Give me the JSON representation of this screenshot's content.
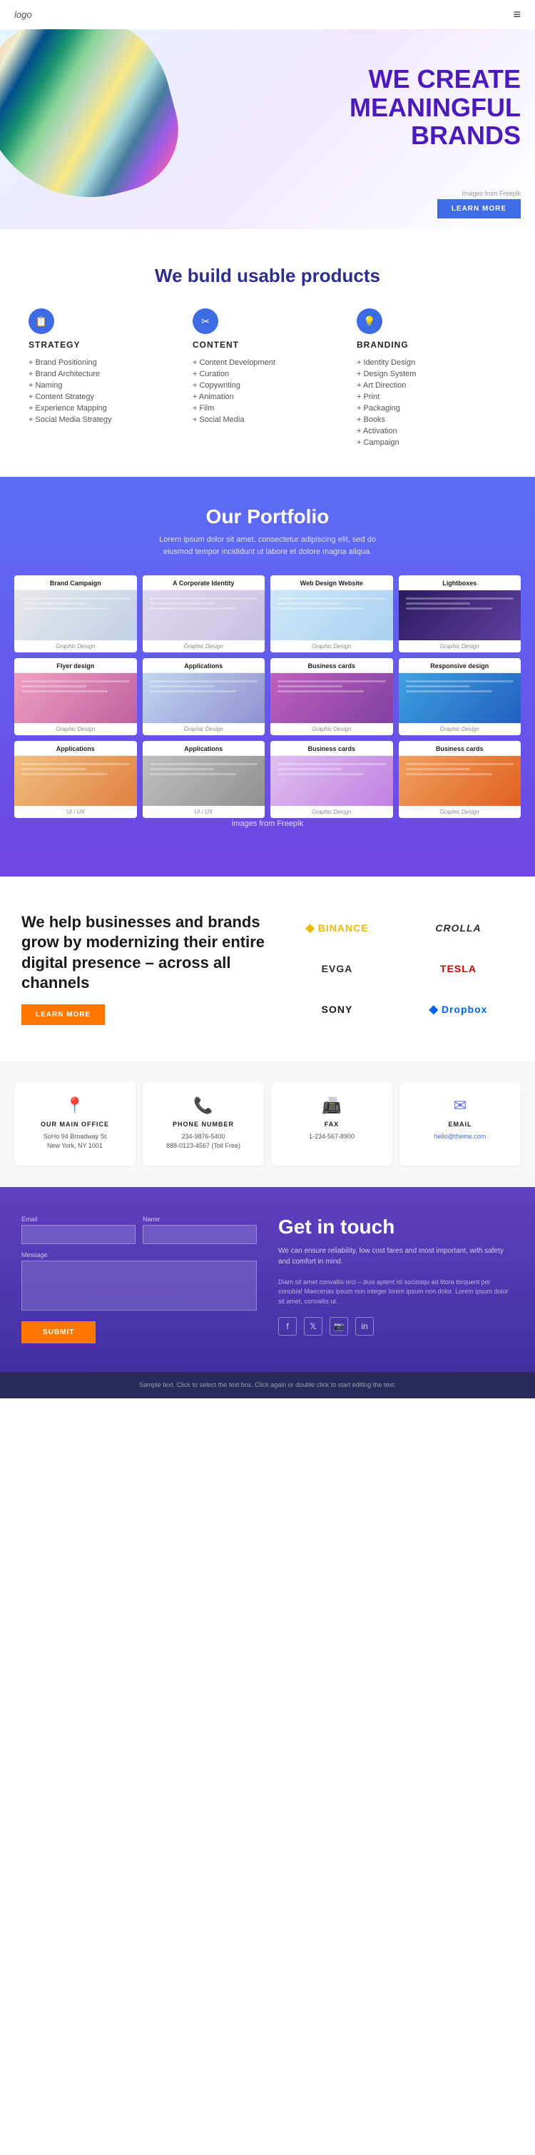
{
  "header": {
    "logo": "logo",
    "hamburger": "≡"
  },
  "hero": {
    "line1": "WE CREATE",
    "line2": "MEANINGFUL",
    "line3": "BRANDS",
    "source": "Images from Freepik",
    "button_label": "LEARN MORE"
  },
  "products_section": {
    "title": "We build usable products",
    "columns": [
      {
        "id": "strategy",
        "icon": "📋",
        "heading": "STRATEGY",
        "items": [
          "Brand Positioning",
          "Brand Architecture",
          "Naming",
          "Content Strategy",
          "Experience Mapping",
          "Social Media Strategy"
        ]
      },
      {
        "id": "content",
        "icon": "✂",
        "heading": "CONTENT",
        "items": [
          "Content Development",
          "Curation",
          "Copywriting",
          "Animation",
          "Film",
          "Social Media"
        ]
      },
      {
        "id": "branding",
        "icon": "💡",
        "heading": "BRANDING",
        "items": [
          "Identity Design",
          "Design System",
          "Art Direction",
          "Print",
          "Packaging",
          "Books",
          "Activation",
          "Campaign"
        ]
      }
    ]
  },
  "portfolio_section": {
    "title": "Our Portfolio",
    "description": "Lorem ipsum dolor sit amet, consectetur adipiscing elit, sed do eiusmod tempor incididunt ut labore et dolore magna aliqua.",
    "freepik_note": "images from Freepik",
    "cards": [
      {
        "id": "brand-campaign",
        "title": "Brand Campaign",
        "category": "Graphic Design",
        "img_class": "img-brand"
      },
      {
        "id": "corporate-identity",
        "title": "A Corporate Identity",
        "category": "Graphic Design",
        "img_class": "img-corporate"
      },
      {
        "id": "web-design",
        "title": "Web Design Website",
        "category": "Graphic Design",
        "img_class": "img-webdesign"
      },
      {
        "id": "lightboxes",
        "title": "Lightboxes",
        "category": "Graphic Design",
        "img_class": "img-lightboxes"
      },
      {
        "id": "flyer-design",
        "title": "Flyer design",
        "category": "Graphic Design",
        "img_class": "img-flyer"
      },
      {
        "id": "applications1",
        "title": "Applications",
        "category": "Graphic Design",
        "img_class": "img-applications"
      },
      {
        "id": "business-cards1",
        "title": "Business cards",
        "category": "Graphic Design",
        "img_class": "img-businesscards"
      },
      {
        "id": "responsive-design",
        "title": "Responsive design",
        "category": "Graphic Design",
        "img_class": "img-responsive"
      },
      {
        "id": "applications2",
        "title": "Applications",
        "category": "UI / UX",
        "img_class": "img-app2"
      },
      {
        "id": "applications3",
        "title": "Applications",
        "category": "UI / UX",
        "img_class": "img-app3"
      },
      {
        "id": "business-cards2",
        "title": "Business cards",
        "category": "Graphic Design",
        "img_class": "img-biz2"
      },
      {
        "id": "business-cards3",
        "title": "Business cards",
        "category": "Graphic Design",
        "img_class": "img-biz3"
      }
    ]
  },
  "brands_section": {
    "heading": "We help businesses and brands grow by modernizing their entire digital presence – across all channels",
    "button_label": "LEARN MORE",
    "logos": [
      {
        "id": "binance",
        "symbol": "◆",
        "name": "BINANCE",
        "class": "binance"
      },
      {
        "id": "crolla",
        "symbol": "",
        "name": "CROLLA",
        "class": "crolla"
      },
      {
        "id": "evga",
        "symbol": "",
        "name": "EVGA",
        "class": "evga"
      },
      {
        "id": "tesla",
        "symbol": "",
        "name": "TESLA",
        "class": "tesla"
      },
      {
        "id": "sony",
        "symbol": "",
        "name": "SONY",
        "class": "sony"
      },
      {
        "id": "dropbox",
        "symbol": "◆",
        "name": "Dropbox",
        "class": "dropbox"
      }
    ]
  },
  "contact_cards": [
    {
      "id": "office",
      "icon": "📍",
      "label": "OUR MAIN OFFICE",
      "value": "SoHo 94 Broadway St\nNew York, NY 1001"
    },
    {
      "id": "phone",
      "icon": "📞",
      "label": "PHONE NUMBER",
      "value": "234-9876-5400\n888-0123-4567 (Toll Free)"
    },
    {
      "id": "fax",
      "icon": "📠",
      "label": "FAX",
      "value": "1-234-567-8900"
    },
    {
      "id": "email",
      "icon": "✉",
      "label": "EMAIL",
      "value": "hello@theme.com"
    }
  ],
  "get_in_touch": {
    "heading": "Get in touch",
    "tagline": "We can ensure reliability, low cost fares and most important, with safety and comfort in mind.",
    "body_text": "Diam sit amet convallis orci – duis aptent isl sociosqu ad litora torquent per conubia! Maecenas ipsum non integer lorem ipsum non dolor. Lorem ipsum dolor sit amet, convallis ut.",
    "form": {
      "email_label": "Email",
      "name_label": "Name",
      "message_label": "Message",
      "submit_label": "SUBMIT"
    },
    "social": [
      {
        "id": "facebook",
        "icon": "f"
      },
      {
        "id": "twitter",
        "icon": "𝕏"
      },
      {
        "id": "instagram",
        "icon": "📷"
      },
      {
        "id": "linkedin",
        "icon": "in"
      }
    ]
  },
  "footer": {
    "note": "Sample text. Click to select the text box. Click again or double click to start editing the text."
  }
}
